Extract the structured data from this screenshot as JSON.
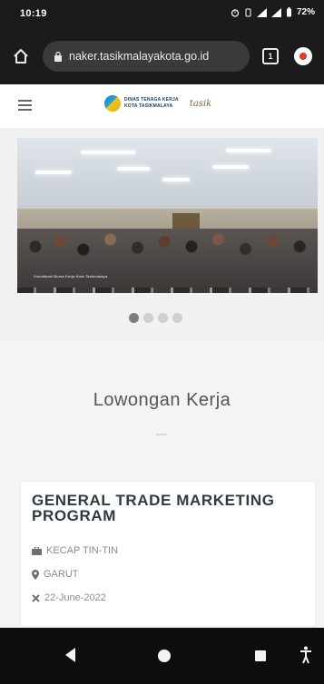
{
  "status_bar": {
    "time": "10:19",
    "battery": "72%"
  },
  "browser": {
    "url": "naker.tasikmalayakota.go.id",
    "tab_count": "1"
  },
  "site_header": {
    "logo_line1": "DINAS TENAGA KERJA",
    "logo_line2": "KOTA TASIKMALAYA",
    "logo_script": "tasik"
  },
  "slider": {
    "caption": "Sosialisasi Bursa Kerja Kota Tasikmalaya",
    "slide_count": 4,
    "active_index": 0
  },
  "section": {
    "title": "Lowongan Kerja"
  },
  "job": {
    "title": "GENERAL TRADE MARKETING PROGRAM",
    "company": "KECAP TIN-TIN",
    "location": "GARUT",
    "date": "22-June-2022"
  },
  "colors": {
    "system_bar": "#1b1b1b",
    "url_pill": "#3a3a3a",
    "menu_accent": "#e8372b",
    "job_title": "#2f3a45",
    "meta_text": "#8c8c8c"
  },
  "icons": {
    "home": "home-icon",
    "lock": "lock-icon",
    "tabs": "tabs-icon",
    "menu": "menu-icon",
    "hamburger": "hamburger-icon",
    "company": "briefcase-icon",
    "location": "map-pin-icon",
    "date": "calendar-icon",
    "nav_back": "back-triangle-icon",
    "nav_home": "home-circle-icon",
    "nav_recent": "recent-square-icon",
    "nav_accessibility": "accessibility-icon"
  }
}
